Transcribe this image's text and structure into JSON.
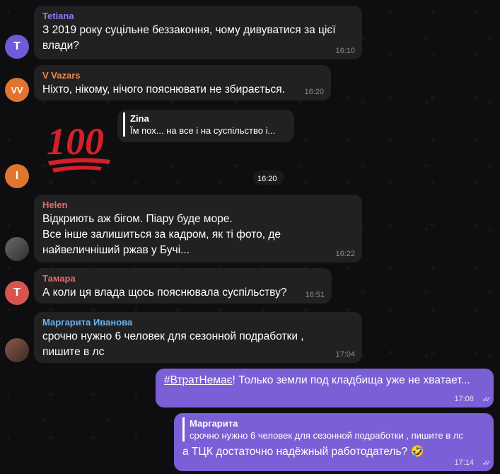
{
  "messages": [
    {
      "sender": "Tetiana",
      "avatar_letter": "T",
      "avatar_color": "#6f5bd8",
      "name_color": "#8b7cf0",
      "text": "З 2019 року суцільне беззаконня, чому дивуватися за цієї\nвлади?",
      "time": "16:10"
    },
    {
      "sender": "V Vazars",
      "avatar_letter": "VV",
      "avatar_color": "#e0752f",
      "name_color": "#ee8a4a",
      "text": "Ніхто, нікому, нічого пояснювати не збирається.",
      "time": "16:20"
    },
    {
      "sender": "",
      "avatar_letter": "I",
      "avatar_color": "#e0752f",
      "reply_name": "Zina",
      "reply_text": "Їм пох... на все і на суспільство і...",
      "time": "16:20"
    },
    {
      "sender": "Helen",
      "name_color": "#e56a6a",
      "text": "Відкриють аж бігом. Піару буде море.\nВсе інше залишиться за кадром, як ті фото, де\nнайвеличніший ржав у Бучі...",
      "time": "16:22"
    },
    {
      "sender": "Тамара",
      "avatar_letter": "T",
      "avatar_color": "#d9534f",
      "name_color": "#e56a6a",
      "text": "А коли ця влада щось пояснювала суспільству?",
      "time": "16:51"
    },
    {
      "sender": "Маргарита Иванова",
      "name_color": "#6ab3f3",
      "text": "срочно нужно 6 человек для сезонной подработки ,\nпишите в лс",
      "time": "17:04"
    }
  ],
  "outgoing": [
    {
      "hashtag": "#ВтратНемає",
      "text": "! Только земли под кладбища уже не хватает...",
      "time": "17:08"
    },
    {
      "reply_name": "Маргарита",
      "reply_text": "срочно нужно 6 человек для сезонной подработки , пишите в лс",
      "text": "а ТЦК достаточно надёжный работодатель? 🤣",
      "time": "17:14"
    }
  ]
}
